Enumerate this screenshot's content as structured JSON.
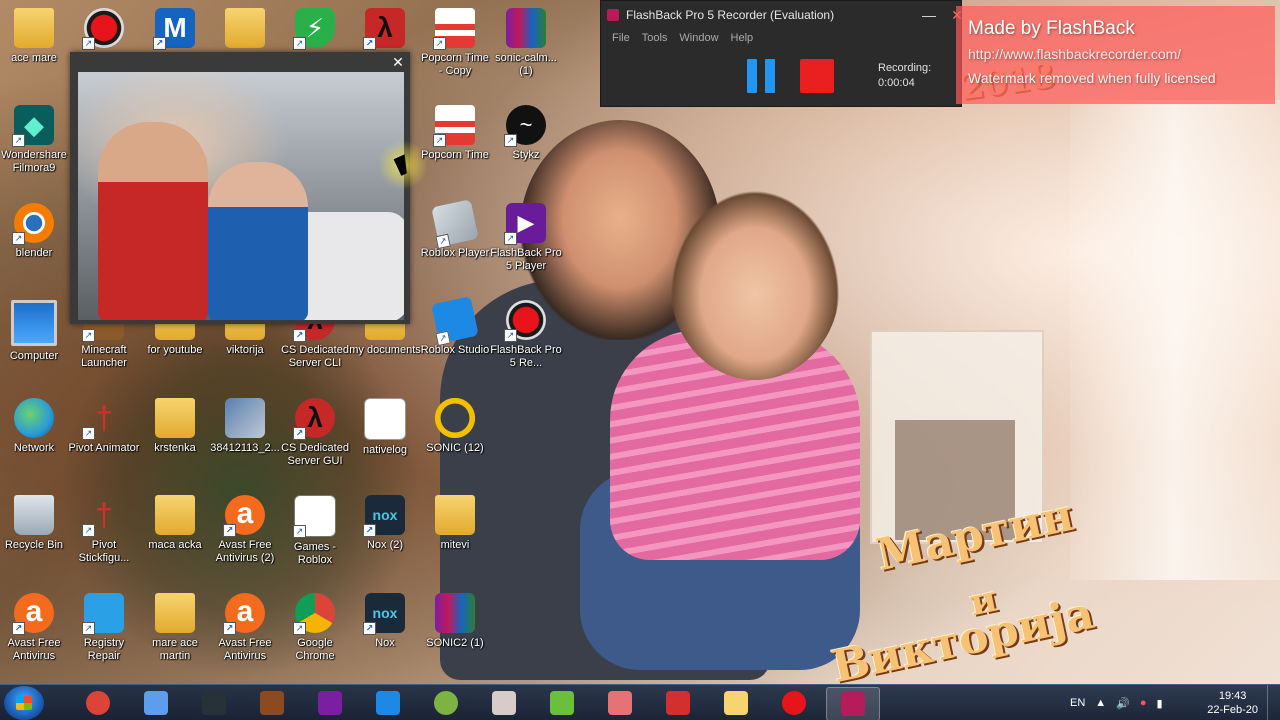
{
  "wallpaper": {
    "year": "2018",
    "text_line1": "Мартин",
    "text_line2": "и",
    "text_line3": "Викторија"
  },
  "watermark": {
    "line1": "Made by FlashBack",
    "line2": "http://www.flashbackrecorder.com/",
    "line3": "Watermark removed when fully licensed"
  },
  "desktop_icons": [
    {
      "label": "ace mare",
      "icon": "user-folder-icon"
    },
    {
      "label": "",
      "icon": "flashback-recorder-icon"
    },
    {
      "label": "",
      "icon": "malwarebytes-icon"
    },
    {
      "label": "",
      "icon": "folder-icon"
    },
    {
      "label": "",
      "icon": "shield-icon"
    },
    {
      "label": "",
      "icon": "half-life-icon"
    },
    {
      "label": "Popcorn Time - Copy",
      "icon": "popcorn-icon"
    },
    {
      "label": "sonic-calm... (1)",
      "icon": "winrar-archive-icon"
    },
    {
      "label": "Wondershare Filmora9",
      "icon": "filmora-icon"
    },
    {
      "label": "Popcorn Time",
      "icon": "popcorn-icon"
    },
    {
      "label": "Stykz",
      "icon": "stykz-icon"
    },
    {
      "label": "blender",
      "icon": "blender-icon"
    },
    {
      "label": "Roblox Player",
      "icon": "roblox-icon"
    },
    {
      "label": "FlashBack Pro 5 Player",
      "icon": "flashback-player-icon"
    },
    {
      "label": "Computer",
      "icon": "computer-icon"
    },
    {
      "label": "Minecraft Launcher",
      "icon": "minecraft-icon"
    },
    {
      "label": "for youtube",
      "icon": "folder-icon"
    },
    {
      "label": "viktorija",
      "icon": "folder-icon"
    },
    {
      "label": "CS Dedicated Server CLI",
      "icon": "cs-server-icon"
    },
    {
      "label": "my documents",
      "icon": "folder-icon"
    },
    {
      "label": "Roblox Studio",
      "icon": "roblox-studio-icon"
    },
    {
      "label": "FlashBack Pro 5 Re...",
      "icon": "flashback-recorder-icon"
    },
    {
      "label": "Network",
      "icon": "network-icon"
    },
    {
      "label": "Pivot Animator",
      "icon": "pivot-icon"
    },
    {
      "label": "krstenka",
      "icon": "folder-icon"
    },
    {
      "label": "38412113_2...",
      "icon": "photo-icon"
    },
    {
      "label": "CS Dedicated Server GUI",
      "icon": "cs-server-icon"
    },
    {
      "label": "nativelog",
      "icon": "text-document-icon"
    },
    {
      "label": "SONIC (12)",
      "icon": "ring-icon"
    },
    {
      "label": "Recycle Bin",
      "icon": "recycle-bin-icon"
    },
    {
      "label": "Pivot Stickfigu...",
      "icon": "pivot-icon"
    },
    {
      "label": "maca acka",
      "icon": "folder-icon"
    },
    {
      "label": "Avast Free Antivirus (2)",
      "icon": "avast-icon"
    },
    {
      "label": "Games - Roblox",
      "icon": "games-icon"
    },
    {
      "label": "Nox (2)",
      "icon": "nox-icon"
    },
    {
      "label": "mitevi",
      "icon": "folder-icon"
    },
    {
      "label": "Avast Free Antivirus",
      "icon": "avast-icon"
    },
    {
      "label": "Registry Repair",
      "icon": "registry-repair-icon"
    },
    {
      "label": "mare ace martin",
      "icon": "folder-icon"
    },
    {
      "label": "Avast Free Antivirus",
      "icon": "avast-icon"
    },
    {
      "label": "Google Chrome",
      "icon": "chrome-icon"
    },
    {
      "label": "Nox",
      "icon": "nox-icon"
    },
    {
      "label": "SONIC2 (1)",
      "icon": "winrar-archive-icon"
    }
  ],
  "webcam": {
    "close_label": "✕"
  },
  "recorder": {
    "title": "FlashBack Pro 5 Recorder (Evaluation)",
    "menu": [
      "File",
      "Tools",
      "Window",
      "Help"
    ],
    "status_label": "Recording:",
    "elapsed": "0:00:04",
    "minimize_label": "—",
    "close_label": "✕"
  },
  "taskbar": {
    "items": [
      {
        "name": "chrome",
        "color": "#db4437"
      },
      {
        "name": "paint",
        "color": "#5c9ded"
      },
      {
        "name": "counter-strike",
        "color": "#263238"
      },
      {
        "name": "fnaf",
        "color": "#8d4a1e"
      },
      {
        "name": "winrar",
        "color": "#7b1fa2"
      },
      {
        "name": "roblox-studio",
        "color": "#1e88e5"
      },
      {
        "name": "spore",
        "color": "#7cb342"
      },
      {
        "name": "masks",
        "color": "#d7ccc8"
      },
      {
        "name": "minecraft",
        "color": "#6bbf3a"
      },
      {
        "name": "clown",
        "color": "#e57373"
      },
      {
        "name": "pivot",
        "color": "#d32f2f"
      },
      {
        "name": "explorer",
        "color": "#f7d470"
      },
      {
        "name": "flashback-recorder",
        "color": "#e8141b"
      },
      {
        "name": "flashback-active",
        "color": "#b71c5a"
      }
    ],
    "language": "EN",
    "time": "19:43",
    "date": "22-Feb-20"
  }
}
